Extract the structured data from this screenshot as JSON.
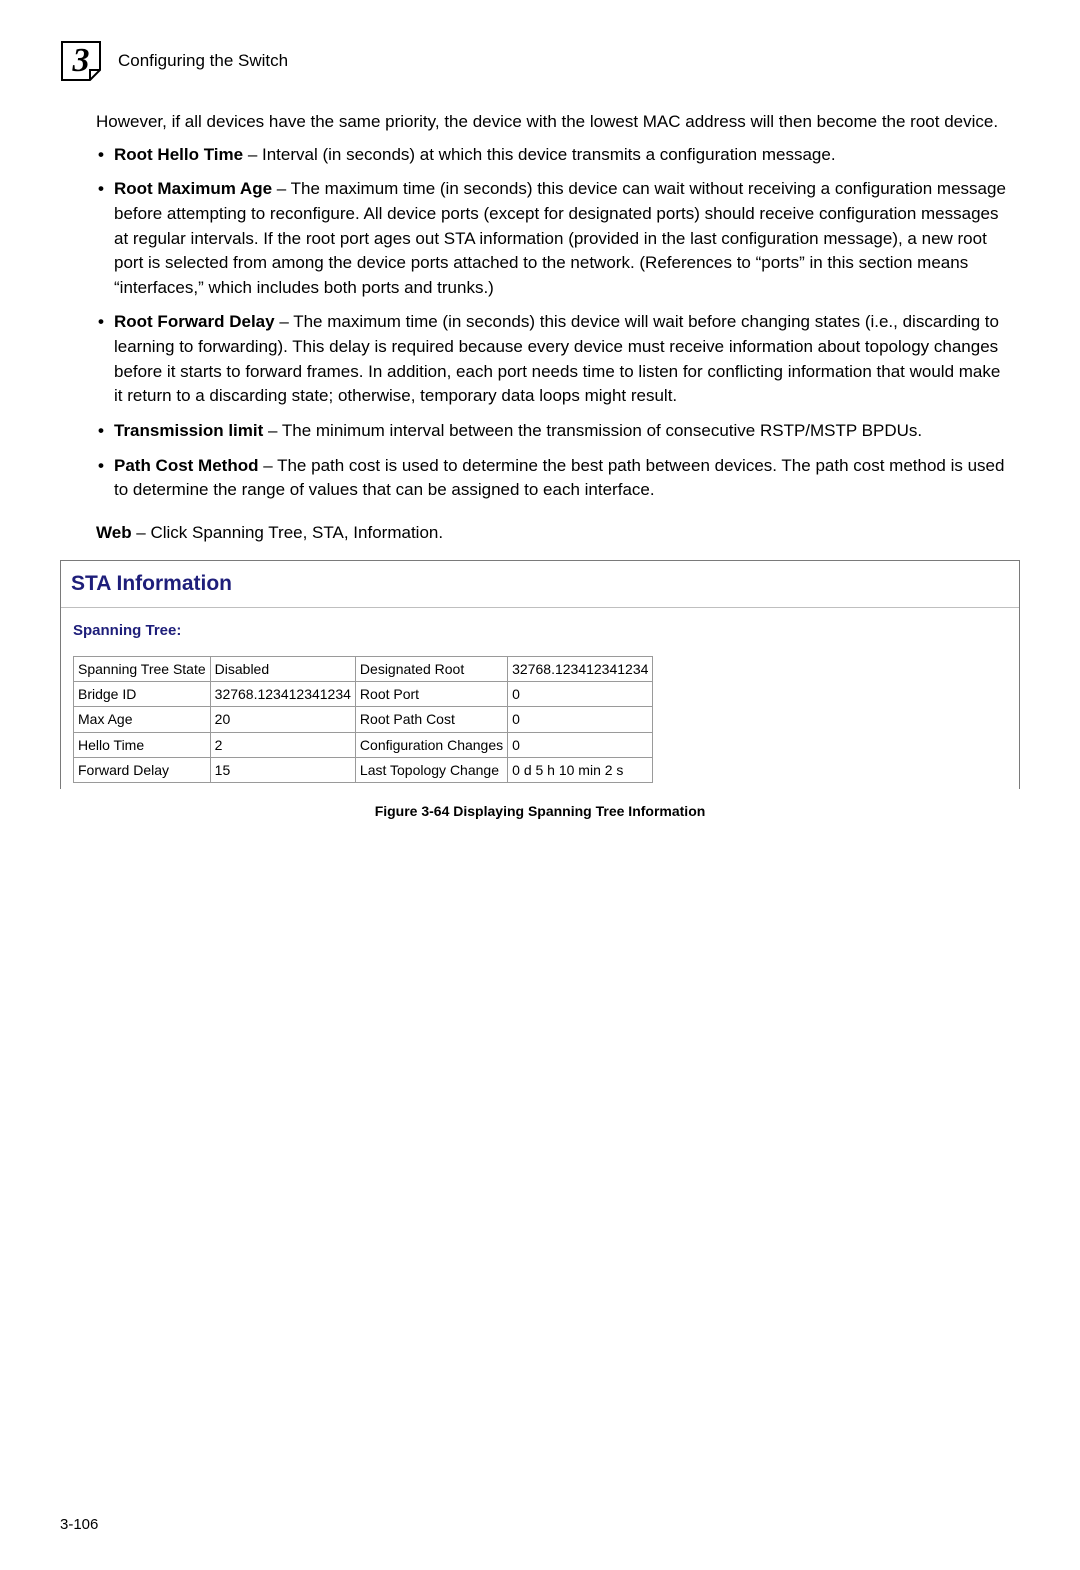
{
  "header": {
    "chapter_number": "3",
    "chapter_title": "Configuring the Switch"
  },
  "intro": "However, if all devices have the same priority, the device with the lowest MAC address will then become the root device.",
  "bullets": [
    {
      "term": "Root Hello Time",
      "text": " – Interval (in seconds) at which this device transmits a configuration message."
    },
    {
      "term": "Root Maximum Age",
      "text": " – The maximum time (in seconds) this device can wait without receiving a configuration message before attempting to reconfigure. All device ports (except for designated ports) should receive configuration messages at regular intervals. If the root port ages out STA information (provided in the last configuration message), a new root port is selected from among the device ports attached to the network. (References to “ports” in this section means “interfaces,” which includes both ports and trunks.)"
    },
    {
      "term": "Root Forward Delay",
      "text": " – The maximum time (in seconds) this device will wait before changing states (i.e., discarding to learning to forwarding). This delay is required because every device must receive information about topology changes before it starts to forward frames. In addition, each port needs time to listen for conflicting information that would make it return to a discarding state; otherwise, temporary data loops might result."
    },
    {
      "term": "Transmission limit",
      "text": " – The minimum interval between the transmission of consecutive RSTP/MSTP BPDUs."
    },
    {
      "term": "Path Cost Method",
      "text": " – The path cost is used to determine the best path between devices. The path cost method is used to determine the range of values that can be assigned to each interface."
    }
  ],
  "web_line": {
    "label": "Web",
    "text": " – Click Spanning Tree, STA, Information."
  },
  "panel": {
    "title": "STA Information",
    "subtitle": "Spanning Tree:",
    "rows": [
      {
        "l1": "Spanning Tree State",
        "v1": "Disabled",
        "l2": "Designated Root",
        "v2": "32768.123412341234"
      },
      {
        "l1": "Bridge ID",
        "v1": "32768.123412341234",
        "l2": "Root Port",
        "v2": "0"
      },
      {
        "l1": "Max Age",
        "v1": "20",
        "l2": "Root Path Cost",
        "v2": "0"
      },
      {
        "l1": "Hello Time",
        "v1": "2",
        "l2": "Configuration Changes",
        "v2": "0"
      },
      {
        "l1": "Forward Delay",
        "v1": "15",
        "l2": "Last Topology Change",
        "v2": "0 d 5 h 10 min 2 s"
      }
    ]
  },
  "figure_caption": "Figure 3-64  Displaying Spanning Tree Information",
  "page_number": "3-106"
}
